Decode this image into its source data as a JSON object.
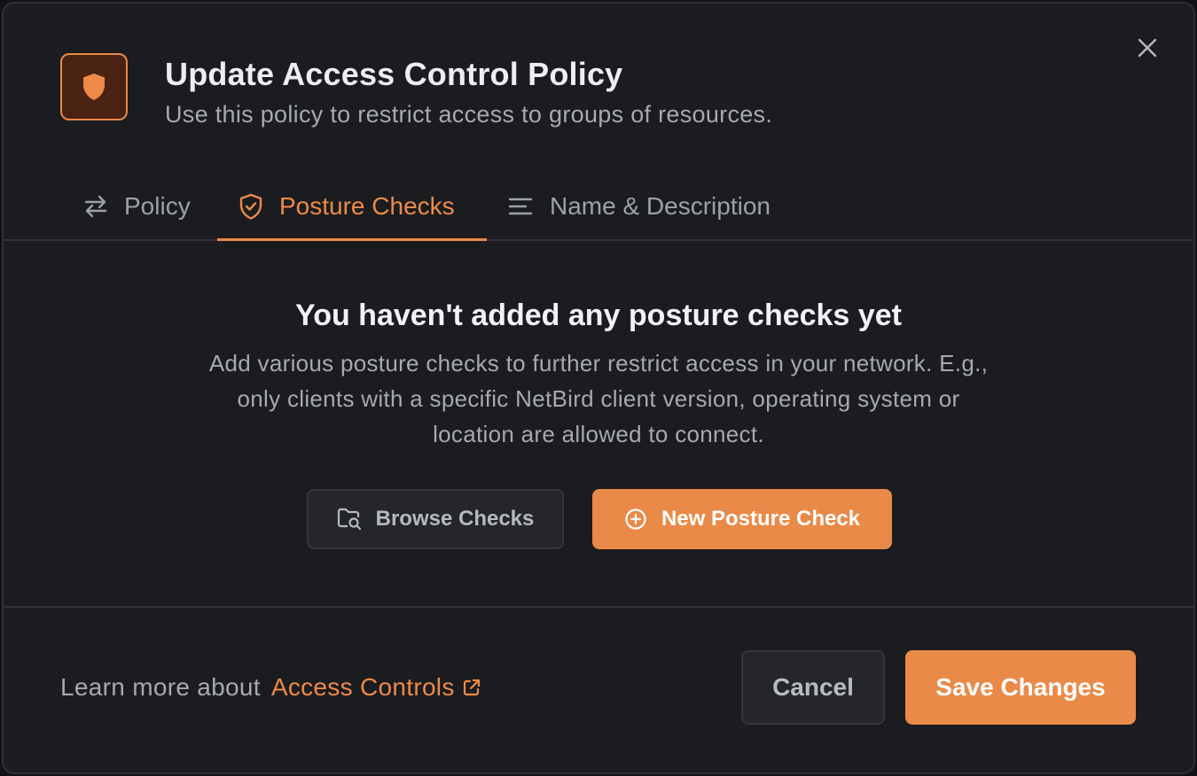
{
  "dialog": {
    "title": "Update Access Control Policy",
    "subtitle": "Use this policy to restrict access to groups of resources.",
    "icon": "shield-icon",
    "accent_color": "#ea8a48"
  },
  "tabs": [
    {
      "label": "Policy",
      "icon": "arrows-exchange-icon",
      "active": false
    },
    {
      "label": "Posture Checks",
      "icon": "shield-check-icon",
      "active": true
    },
    {
      "label": "Name & Description",
      "icon": "text-lines-icon",
      "active": false
    }
  ],
  "empty_state": {
    "title": "You haven't added any posture checks yet",
    "description": "Add various posture checks to further restrict access in your network. E.g., only clients with a specific NetBird client version, operating system or location are allowed to connect.",
    "browse_label": "Browse Checks",
    "new_label": "New Posture Check"
  },
  "footer": {
    "learn_prefix": "Learn more about",
    "learn_link": "Access Controls",
    "cancel_label": "Cancel",
    "save_label": "Save Changes"
  }
}
